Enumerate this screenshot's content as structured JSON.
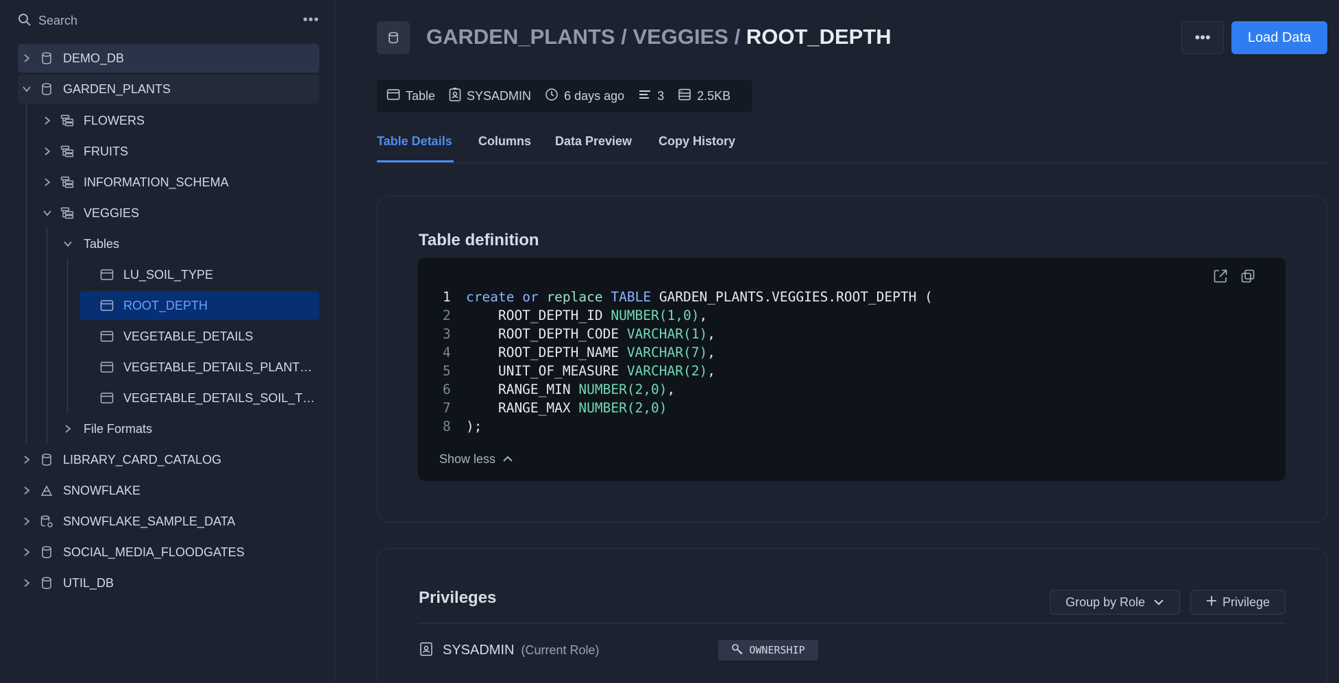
{
  "search": {
    "placeholder": "Search",
    "more": "•••"
  },
  "tree": [
    {
      "label": "DEMO_DB",
      "icon": "database-icon"
    },
    {
      "label": "GARDEN_PLANTS",
      "icon": "database-icon"
    },
    {
      "label": "FLOWERS",
      "icon": "schema-icon"
    },
    {
      "label": "FRUITS",
      "icon": "schema-icon"
    },
    {
      "label": "INFORMATION_SCHEMA",
      "icon": "schema-icon"
    },
    {
      "label": "VEGGIES",
      "icon": "schema-icon"
    },
    {
      "label": "Tables",
      "icon": ""
    },
    {
      "label": "LU_SOIL_TYPE",
      "icon": "table-icon"
    },
    {
      "label": "ROOT_DEPTH",
      "icon": "table-icon"
    },
    {
      "label": "VEGETABLE_DETAILS",
      "icon": "table-icon"
    },
    {
      "label": "VEGETABLE_DETAILS_PLANT…",
      "icon": "table-icon"
    },
    {
      "label": "VEGETABLE_DETAILS_SOIL_T…",
      "icon": "table-icon"
    },
    {
      "label": "File Formats",
      "icon": ""
    },
    {
      "label": "LIBRARY_CARD_CATALOG",
      "icon": "database-icon"
    },
    {
      "label": "SNOWFLAKE",
      "icon": "snowflake-share-icon"
    },
    {
      "label": "SNOWFLAKE_SAMPLE_DATA",
      "icon": "shared-database-icon"
    },
    {
      "label": "SOCIAL_MEDIA_FLOODGATES",
      "icon": "database-icon"
    },
    {
      "label": "UTIL_DB",
      "icon": "database-icon"
    }
  ],
  "header": {
    "path_db": "GARDEN_PLANTS",
    "sep1": " / ",
    "path_schema": "VEGGIES",
    "sep2": " / ",
    "path_table": "ROOT_DEPTH",
    "more_label": "•••",
    "load_label": "Load Data"
  },
  "meta": {
    "kind": "Table",
    "owner": "SYSADMIN",
    "modified": "6 days ago",
    "columns": "3",
    "size": "2.5KB"
  },
  "tabs": [
    "Table Details",
    "Columns",
    "Data Preview",
    "Copy History"
  ],
  "definition": {
    "title": "Table definition",
    "show_less": "Show less",
    "line_numbers": [
      "1",
      "2",
      "3",
      "4",
      "5",
      "6",
      "7",
      "8"
    ],
    "code": {
      "l1_create": "create",
      "l1_or": "or",
      "l1_replace": "replace",
      "l1_table": "TABLE",
      "l1_rest": " GARDEN_PLANTS.VEGGIES.ROOT_DEPTH (",
      "l2_col": "    ROOT_DEPTH_ID ",
      "l2_type": "NUMBER",
      "l2_args": "(1,0)",
      "l2_end": ",",
      "l3_col": "    ROOT_DEPTH_CODE ",
      "l3_type": "VARCHAR",
      "l3_args": "(1)",
      "l3_end": ",",
      "l4_col": "    ROOT_DEPTH_NAME ",
      "l4_type": "VARCHAR",
      "l4_args": "(7)",
      "l4_end": ",",
      "l5_col": "    UNIT_OF_MEASURE ",
      "l5_type": "VARCHAR",
      "l5_args": "(2)",
      "l5_end": ",",
      "l6_col": "    RANGE_MIN ",
      "l6_type": "NUMBER",
      "l6_args": "(2,0)",
      "l6_end": ",",
      "l7_col": "    RANGE_MAX ",
      "l7_type": "NUMBER",
      "l7_args": "(2,0)",
      "l8": ");"
    }
  },
  "privileges": {
    "title": "Privileges",
    "group_by": "Group by Role",
    "add_privilege": "Privilege",
    "role": "SYSADMIN",
    "role_note": "(Current Role)",
    "badge": "OWNERSHIP"
  },
  "colors": {
    "accent": "#2f7df0",
    "selected_row": "#072f73",
    "background": "#1c2230"
  }
}
